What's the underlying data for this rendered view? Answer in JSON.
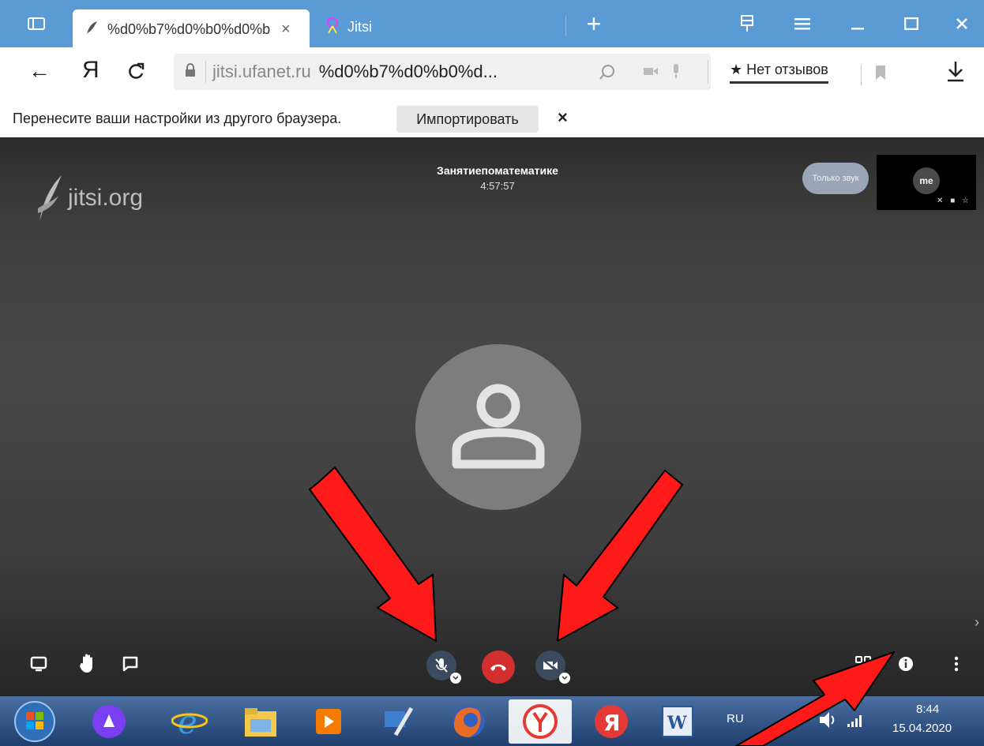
{
  "browser": {
    "tabs": [
      {
        "title": "%d0%b7%d0%b0%d0%b",
        "active": true
      },
      {
        "title": "Jitsi",
        "active": false
      }
    ],
    "new_tab_symbol": "+",
    "url_host": "jitsi.ufanet.ru",
    "url_path": "%d0%b7%d0%b0%d...",
    "reviews_label": "Нет отзывов",
    "back_symbol": "←",
    "yandex_symbol": "Я"
  },
  "import_bar": {
    "message": "Перенесите ваши настройки из другого браузера.",
    "import_button": "Импортировать",
    "close_symbol": "×"
  },
  "conference": {
    "logo_text": "jitsi.org",
    "title": "Занятиепоматематике",
    "duration": "4:57:57",
    "audio_only_label": "Только звук",
    "self_avatar_label": "me"
  },
  "taskbar": {
    "language": "RU",
    "time": "8:44",
    "date": "15.04.2020"
  },
  "colors": {
    "titlebar": "#5b9bd5",
    "hangup": "#d32f2f",
    "arrow": "#ff1a1a"
  }
}
